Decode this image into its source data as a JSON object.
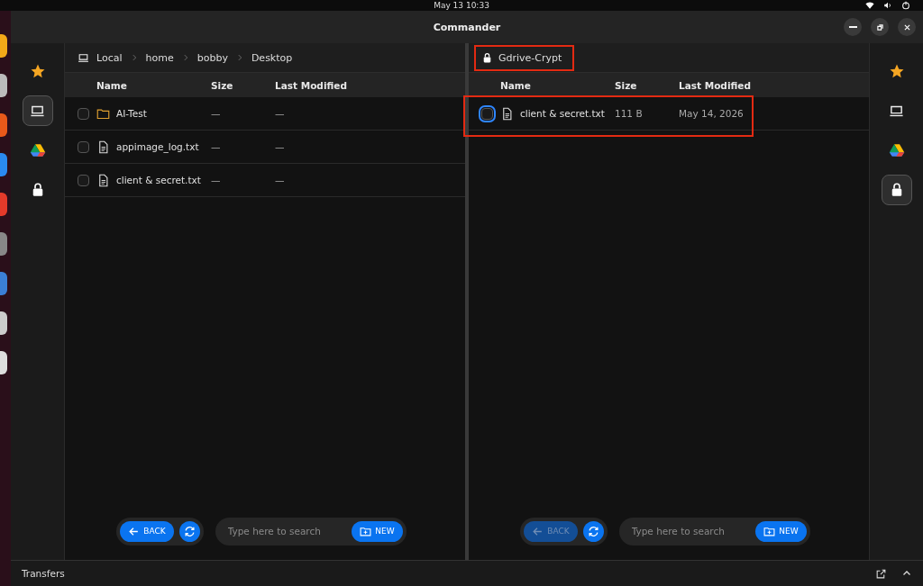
{
  "top_bar": {
    "clock": "May 13  10:33"
  },
  "window": {
    "title": "Commander"
  },
  "panes": [
    {
      "sidebar": [
        {
          "kind": "favorites",
          "selected": false
        },
        {
          "kind": "local",
          "selected": true
        },
        {
          "kind": "gdrive",
          "selected": false
        },
        {
          "kind": "crypt",
          "selected": false
        }
      ],
      "location": {
        "kind": "local",
        "segments": [
          "Local",
          "home",
          "bobby",
          "Desktop"
        ],
        "highlighted": false
      },
      "columns": [
        "Name",
        "Size",
        "Last Modified"
      ],
      "rows": [
        {
          "kind": "folder",
          "name": "AI-Test",
          "size": "—",
          "modified": "—",
          "checked": false,
          "focused": false,
          "highlighted": false
        },
        {
          "kind": "file",
          "name": "appimage_log.txt",
          "size": "—",
          "modified": "—",
          "checked": false,
          "focused": false,
          "highlighted": false
        },
        {
          "kind": "file",
          "name": "client & secret.txt",
          "size": "—",
          "modified": "—",
          "checked": false,
          "focused": false,
          "highlighted": false
        }
      ],
      "toolbar": {
        "back": {
          "label": "BACK",
          "disabled": false
        },
        "search": {
          "placeholder": "Type here to search"
        },
        "new": "NEW"
      }
    },
    {
      "sidebar": [
        {
          "kind": "favorites",
          "selected": false
        },
        {
          "kind": "local",
          "selected": false
        },
        {
          "kind": "gdrive",
          "selected": false
        },
        {
          "kind": "crypt",
          "selected": true
        }
      ],
      "location": {
        "kind": "crypt",
        "segments": [
          "Gdrive-Crypt"
        ],
        "highlighted": true
      },
      "columns": [
        "Name",
        "Size",
        "Last Modified"
      ],
      "rows": [
        {
          "kind": "file",
          "name": "client & secret.txt",
          "size": "111 B",
          "modified": "May 14, 2026",
          "checked": false,
          "focused": true,
          "highlighted": true
        }
      ],
      "toolbar": {
        "back": {
          "label": "BACK",
          "disabled": true
        },
        "search": {
          "placeholder": "Type here to search"
        },
        "new": "NEW"
      }
    }
  ],
  "status_bar": {
    "label": "Transfers"
  }
}
